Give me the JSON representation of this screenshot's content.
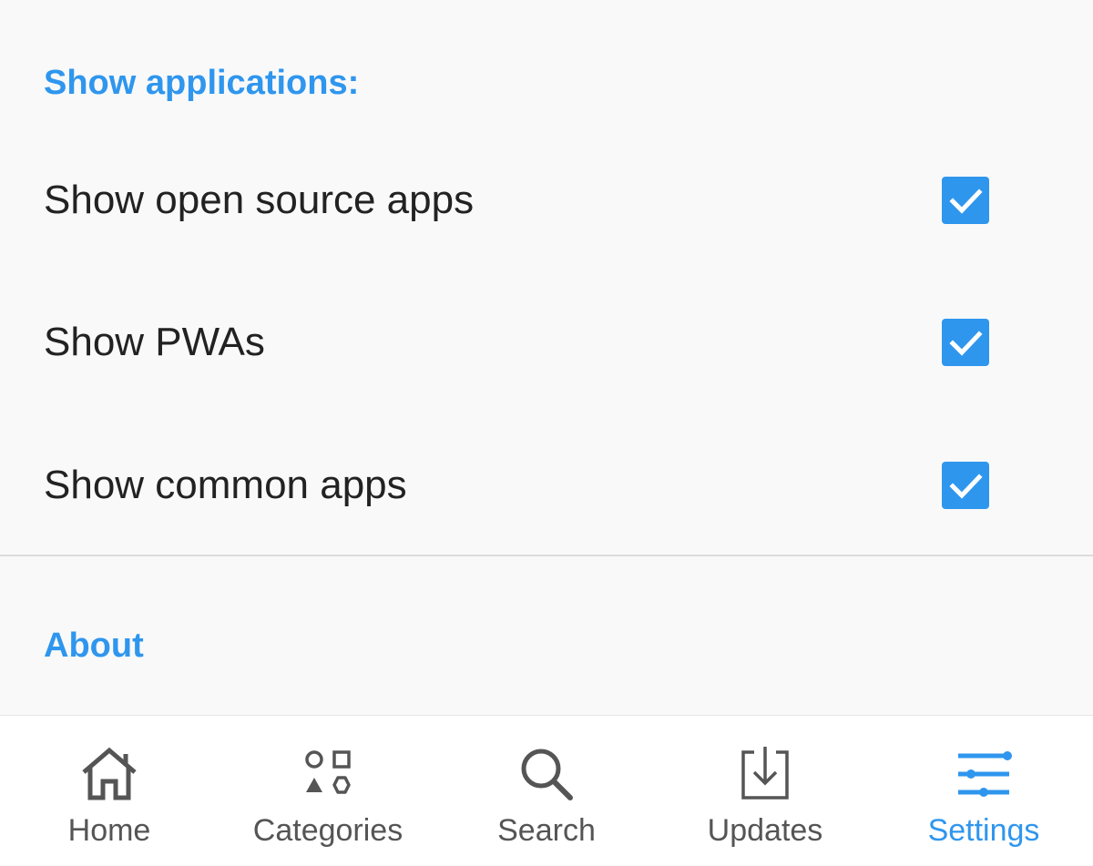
{
  "colors": {
    "accent": "#2f96ee",
    "text": "#222222",
    "nav_inactive": "#555555",
    "background": "#f9f9f9"
  },
  "sections": {
    "show_applications": {
      "title": "Show applications:",
      "items": [
        {
          "label": "Show open source apps",
          "checked": true
        },
        {
          "label": "Show PWAs",
          "checked": true
        },
        {
          "label": "Show common apps",
          "checked": true
        }
      ]
    },
    "about": {
      "title": "About"
    }
  },
  "bottom_nav": {
    "active": "settings",
    "items": [
      {
        "id": "home",
        "label": "Home",
        "icon": "home-icon"
      },
      {
        "id": "categories",
        "label": "Categories",
        "icon": "categories-icon"
      },
      {
        "id": "search",
        "label": "Search",
        "icon": "search-icon"
      },
      {
        "id": "updates",
        "label": "Updates",
        "icon": "download-icon"
      },
      {
        "id": "settings",
        "label": "Settings",
        "icon": "sliders-icon"
      }
    ]
  }
}
